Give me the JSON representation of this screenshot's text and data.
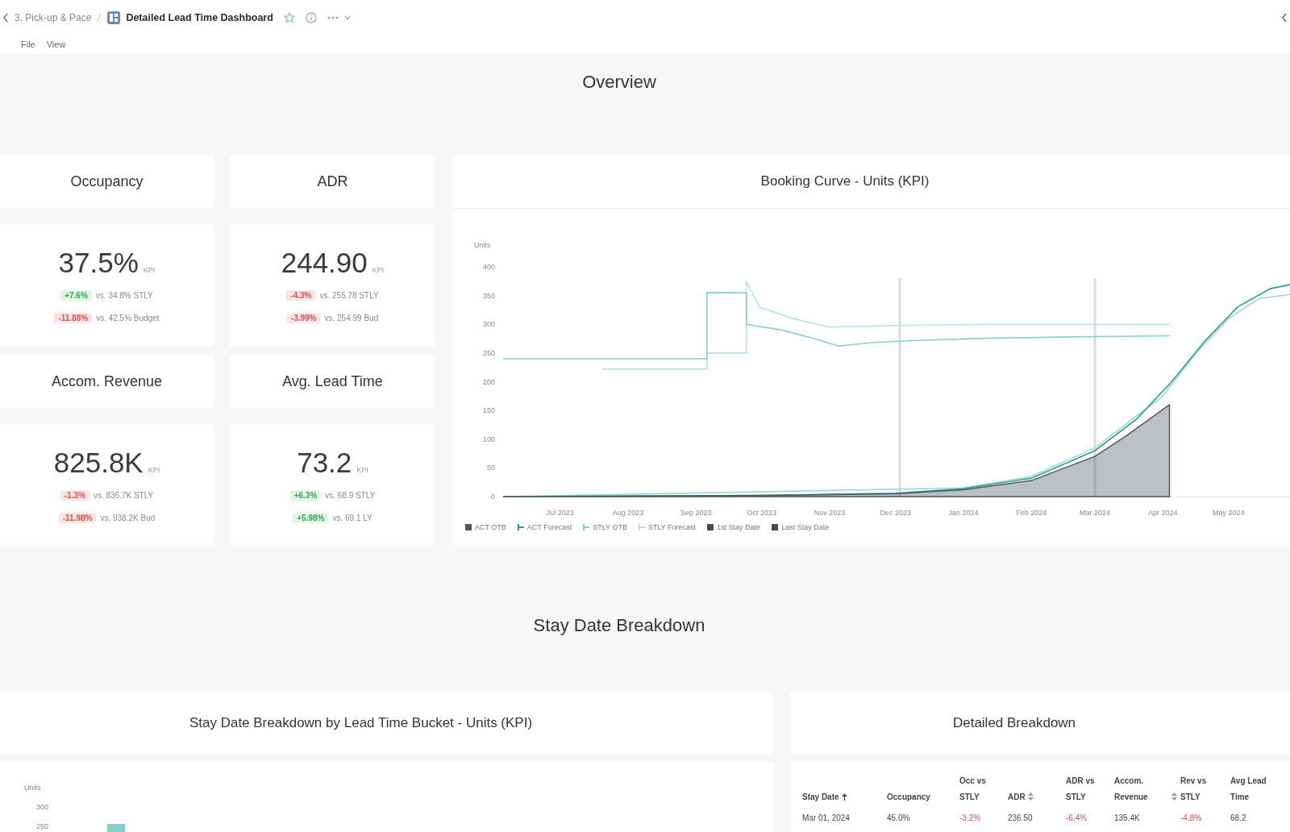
{
  "breadcrumb": [
    {
      "label": "3. Pick-up & Pace",
      "current": false
    },
    {
      "label": "Detailed Lead Time Dashboard",
      "current": true
    }
  ],
  "menu": [
    "File",
    "View"
  ],
  "overview": {
    "title": "Overview",
    "kpis": [
      {
        "title": "Occupancy",
        "value": "37.5%",
        "unit": "KPI",
        "comparisons": [
          {
            "delta": "+7.6%",
            "kind": "positive",
            "text": "vs. 34.8% STLY"
          },
          {
            "delta": "-11.88%",
            "kind": "negative",
            "text": "vs. 42.5% Budget"
          }
        ]
      },
      {
        "title": "ADR",
        "value": "244.90",
        "unit": "KPI",
        "comparisons": [
          {
            "delta": "-4.3%",
            "kind": "negative",
            "text": "vs. 255.78 STLY"
          },
          {
            "delta": "-3.99%",
            "kind": "negative",
            "text": "vs. 254.99 Bud"
          }
        ]
      },
      {
        "title": "Accom. Revenue",
        "value": "825.8K",
        "unit": "KPI",
        "comparisons": [
          {
            "delta": "-1.3%",
            "kind": "negative",
            "text": "vs. 836.7K STLY"
          },
          {
            "delta": "-11.98%",
            "kind": "negative",
            "text": "vs. 938.2K Bud"
          }
        ]
      },
      {
        "title": "Avg. Lead Time",
        "value": "73.2",
        "unit": "KPI",
        "comparisons": [
          {
            "delta": "+6.3%",
            "kind": "positive",
            "text": "vs. 68.9 STLY"
          },
          {
            "delta": "+5.98%",
            "kind": "positive",
            "text": "vs. 69.1 LY"
          }
        ]
      }
    ],
    "booking_curve": {
      "title": "Booking Curve - Units (KPI)",
      "chart_data": [
        {
          "type": "line",
          "ylabel": "Units",
          "xlim": [
            "2023-06-05",
            "2024-05-29"
          ],
          "ylim": [
            0,
            400
          ],
          "yticks": [
            0,
            50,
            100,
            150,
            200,
            250,
            300,
            350,
            400
          ],
          "xticks": [
            {
              "value": "2023-07-01",
              "label": "Jul 2023"
            },
            {
              "value": "2023-08-01",
              "label": "Aug 2023"
            },
            {
              "value": "2023-09-01",
              "label": "Sep 2023"
            },
            {
              "value": "2023-10-01",
              "label": "Oct 2023"
            },
            {
              "value": "2023-11-01",
              "label": "Nov 2023"
            },
            {
              "value": "2023-12-01",
              "label": "Dec 2023"
            },
            {
              "value": "2024-01-01",
              "label": "Jan 2024"
            },
            {
              "value": "2024-02-01",
              "label": "Feb 2024"
            },
            {
              "value": "2024-03-01",
              "label": "Mar 2024"
            },
            {
              "value": "2024-04-01",
              "label": "Apr 2024"
            },
            {
              "value": "2024-05-01",
              "label": "May 2024"
            }
          ],
          "series": [
            {
              "name": "ACT OTB",
              "type": "area",
              "color": "#4b5a5e",
              "x": [
                "2023-06-05",
                "2023-10-01",
                "2023-12-01",
                "2024-01-01",
                "2024-02-01",
                "2024-03-01",
                "2024-03-15",
                "2024-04-04"
              ],
              "values": [
                0,
                2,
                5,
                12,
                28,
                70,
                105,
                160
              ]
            },
            {
              "name": "ACT Forecast",
              "type": "line",
              "color": "#2a9d94",
              "x": [
                "2023-06-05",
                "2023-10-01",
                "2023-12-01",
                "2024-01-01",
                "2024-02-01",
                "2024-03-01",
                "2024-03-20",
                "2024-04-05",
                "2024-04-20",
                "2024-05-05",
                "2024-05-20",
                "2024-05-29"
              ],
              "values": [
                0,
                2,
                6,
                14,
                32,
                80,
                135,
                200,
                270,
                330,
                362,
                369
              ]
            },
            {
              "name": "STLY OTB",
              "type": "line",
              "color": "#86d0cb",
              "x": [
                "2023-06-05",
                "2023-09-06",
                "2023-09-06",
                "2023-09-24",
                "2023-09-24",
                "2023-10-10",
                "2023-10-25",
                "2023-11-05",
                "2023-11-20",
                "2023-12-10",
                "2024-01-15",
                "2024-02-20",
                "2024-04-04"
              ],
              "values": [
                240,
                240,
                355,
                355,
                300,
                290,
                275,
                262,
                268,
                272,
                276,
                278,
                280
              ]
            },
            {
              "name": "STLY Forecast",
              "type": "line",
              "color": "#b2e3df",
              "x": [
                "2023-07-20",
                "2023-09-06",
                "2023-09-06",
                "2023-09-24",
                "2023-09-24",
                "2023-09-30",
                "2023-10-15",
                "2023-11-01",
                "2023-12-01",
                "2024-01-15",
                "2024-04-04"
              ],
              "values": [
                222,
                222,
                250,
                250,
                375,
                330,
                310,
                295,
                298,
                300,
                300
              ]
            },
            {
              "type": "line",
              "color": "#9ad9d4",
              "x": [
                "2023-06-05",
                "2024-01-01",
                "2024-02-01",
                "2024-03-01",
                "2024-04-01",
                "2024-04-15",
                "2024-05-01",
                "2024-05-15",
                "2024-05-29"
              ],
              "values": [
                0,
                15,
                35,
                85,
                175,
                245,
                310,
                345,
                352
              ]
            }
          ],
          "ref_lines": [
            {
              "axis": "x",
              "value": "2023-12-03",
              "label": "1st Stay Date",
              "color": "#4a4a4a"
            },
            {
              "axis": "x",
              "value": "2024-03-01",
              "label": "Last Stay Date",
              "color": "#4a4a4a"
            }
          ],
          "legend": "bottom"
        }
      ]
    }
  },
  "stay_date_breakdown": {
    "title": "Stay Date Breakdown",
    "lead_time_chart": {
      "title": "Stay Date Breakdown by Lead Time Bucket - Units (KPI)",
      "axis_title": "Units",
      "scale_labels": [
        "300",
        "250"
      ]
    },
    "detailed_breakdown": {
      "title": "Detailed Breakdown",
      "columns": [
        {
          "label": "Stay Date",
          "sorted": true,
          "sortable": true
        },
        {
          "label": "Occupancy",
          "sorted": false,
          "sortable": false
        },
        {
          "label": "Occ vs STLY",
          "sorted": false,
          "sortable": false
        },
        {
          "label": "ADR",
          "sorted": false,
          "sortable": true
        },
        {
          "label": "ADR vs STLY",
          "sorted": false,
          "sortable": false
        },
        {
          "label": "Accom. Revenue",
          "sorted": false,
          "sortable": true
        },
        {
          "label": "Rev vs STLY",
          "sorted": false,
          "sortable": false
        },
        {
          "label": "Avg Lead Time",
          "sorted": false,
          "sortable": false
        }
      ],
      "rows": [
        [
          {
            "text": "Mar 01, 2024"
          },
          {
            "text": "45.0%"
          },
          {
            "text": "-3.2%",
            "kind": "negative"
          },
          {
            "text": "236.50"
          },
          {
            "text": "-6.4%",
            "kind": "negative"
          },
          {
            "text": "135.4K"
          },
          {
            "text": "-4.8%",
            "kind": "negative"
          },
          {
            "text": "68.2"
          }
        ]
      ]
    }
  }
}
